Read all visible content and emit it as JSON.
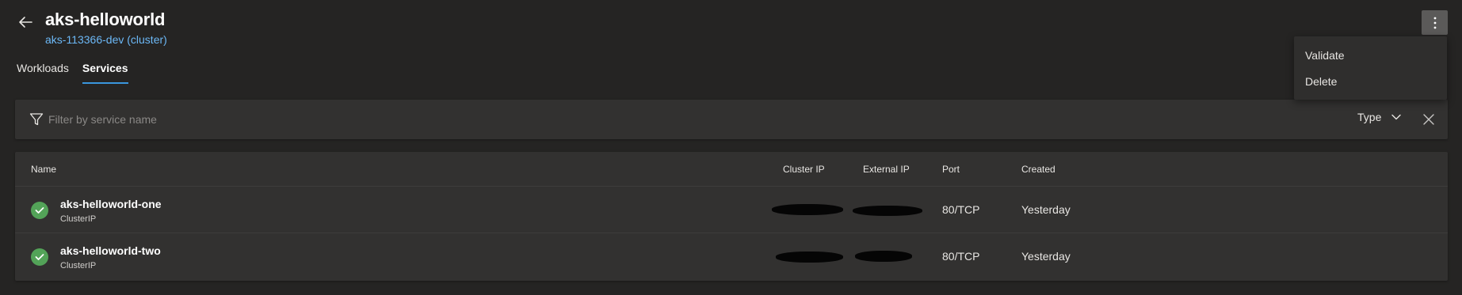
{
  "header": {
    "title": "aks-helloworld",
    "subtitle": "aks-113366-dev (cluster)"
  },
  "tabs": [
    {
      "label": "Workloads",
      "active": false
    },
    {
      "label": "Services",
      "active": true
    }
  ],
  "menu": {
    "items": [
      {
        "label": "Validate"
      },
      {
        "label": "Delete"
      }
    ]
  },
  "filter": {
    "placeholder": "Filter by service name",
    "value": "",
    "type_label": "Type"
  },
  "table": {
    "columns": {
      "name": "Name",
      "cluster_ip": "Cluster IP",
      "external_ip": "External IP",
      "port": "Port",
      "created": "Created"
    },
    "rows": [
      {
        "name": "aks-helloworld-one",
        "type": "ClusterIP",
        "status": "success",
        "cluster_ip": "",
        "external_ip": "",
        "port": "80/TCP",
        "created": "Yesterday"
      },
      {
        "name": "aks-helloworld-two",
        "type": "ClusterIP",
        "status": "success",
        "cluster_ip": "",
        "external_ip": "",
        "port": "80/TCP",
        "created": "Yesterday"
      }
    ]
  },
  "colors": {
    "background": "#252423",
    "panel": "#323130",
    "accent": "#3a96dd",
    "link": "#6cb8f6",
    "success": "#53a358"
  },
  "icons": {
    "back": "arrow-left-icon",
    "more": "more-vertical-icon",
    "filter": "filter-icon",
    "chevron": "chevron-down-icon",
    "clear": "close-icon",
    "status": "check-circle-icon"
  }
}
